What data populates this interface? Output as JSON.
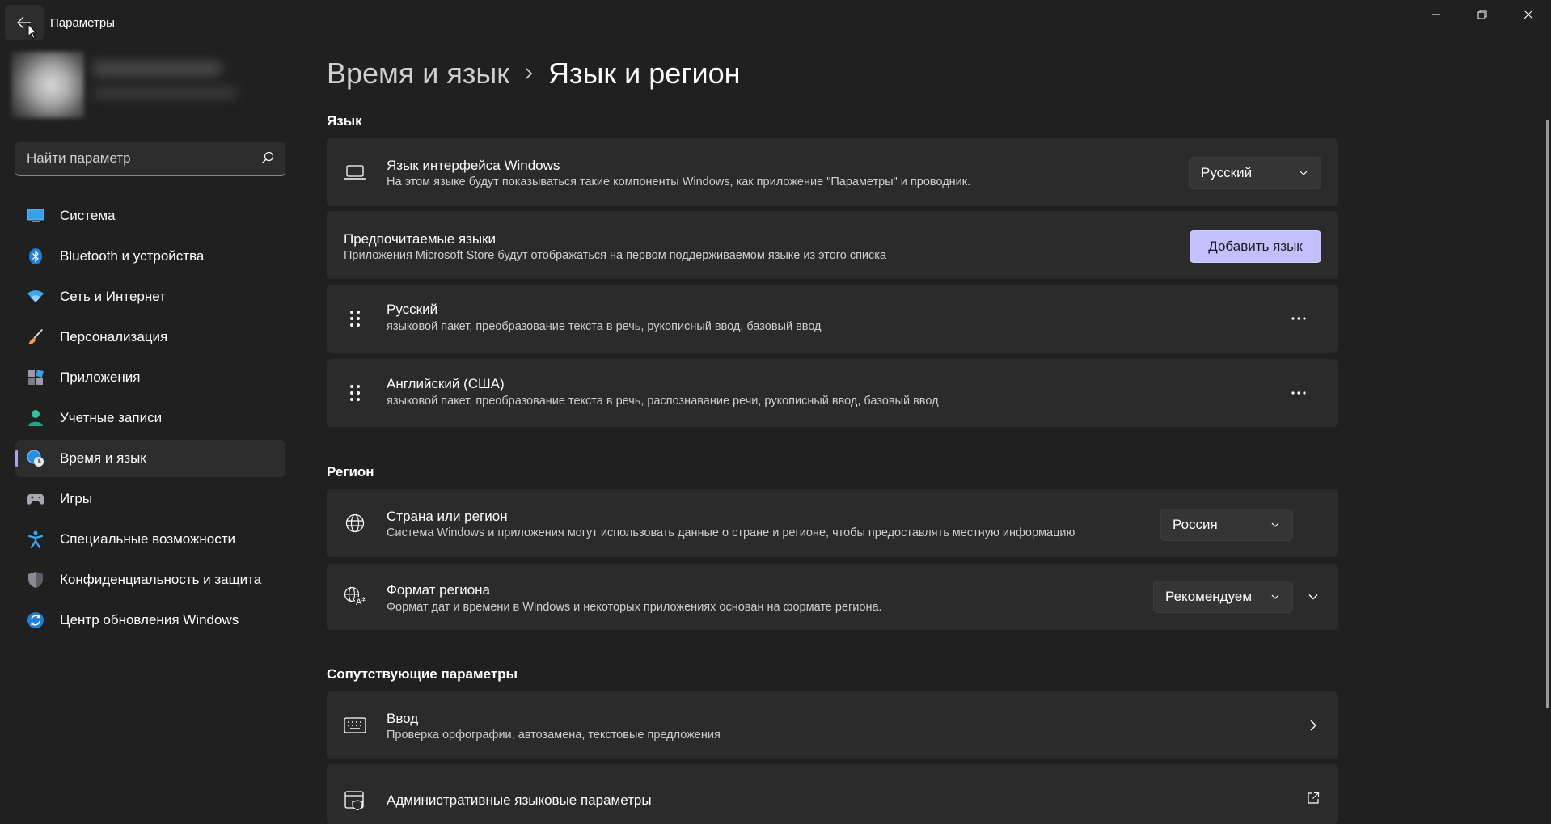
{
  "window": {
    "app_title": "Параметры",
    "minimize_icon": "minimize-icon",
    "maximize_icon": "restore-icon",
    "close_icon": "close-icon"
  },
  "sidebar": {
    "search_placeholder": "Найти параметр",
    "items": [
      {
        "label": "Система",
        "icon": "system-icon",
        "active": false
      },
      {
        "label": "Bluetooth и устройства",
        "icon": "bluetooth-icon",
        "active": false
      },
      {
        "label": "Сеть и Интернет",
        "icon": "wifi-icon",
        "active": false
      },
      {
        "label": "Персонализация",
        "icon": "brush-icon",
        "active": false
      },
      {
        "label": "Приложения",
        "icon": "apps-icon",
        "active": false
      },
      {
        "label": "Учетные записи",
        "icon": "person-icon",
        "active": false
      },
      {
        "label": "Время и язык",
        "icon": "time-language-icon",
        "active": true
      },
      {
        "label": "Игры",
        "icon": "gamepad-icon",
        "active": false
      },
      {
        "label": "Специальные возможности",
        "icon": "accessibility-icon",
        "active": false
      },
      {
        "label": "Конфиденциальность и защита",
        "icon": "shield-icon",
        "active": false
      },
      {
        "label": "Центр обновления Windows",
        "icon": "update-icon",
        "active": false
      }
    ]
  },
  "main": {
    "breadcrumb_parent": "Время и язык",
    "breadcrumb_current": "Язык и регион",
    "language_section": {
      "title": "Язык",
      "display_language": {
        "title": "Язык интерфейса Windows",
        "subtitle": "На этом языке будут показываться такие компоненты Windows, как приложение \"Параметры\" и проводник.",
        "value": "Русский"
      },
      "preferred": {
        "title": "Предпочитаемые языки",
        "subtitle": "Приложения Microsoft Store будут отображаться на первом поддерживаемом языке из этого списка",
        "button": "Добавить язык"
      },
      "languages": [
        {
          "name": "Русский",
          "features": "языковой пакет, преобразование текста в речь, рукописный ввод, базовый ввод"
        },
        {
          "name": "Английский (США)",
          "features": "языковой пакет, преобразование текста в речь, распознавание речи, рукописный ввод, базовый ввод"
        }
      ]
    },
    "region_section": {
      "title": "Регион",
      "country": {
        "title": "Страна или регион",
        "subtitle": "Система Windows и приложения могут использовать данные о стране и регионе, чтобы предоставлять местную информацию",
        "value": "Россия"
      },
      "format": {
        "title": "Формат региона",
        "subtitle": "Формат дат и времени в Windows и некоторых приложениях основан на формате региона.",
        "value": "Рекомендуем"
      }
    },
    "related_section": {
      "title": "Сопутствующие параметры",
      "typing": {
        "title": "Ввод",
        "subtitle": "Проверка орфографии, автозамена, текстовые предложения"
      },
      "admin": {
        "title": "Административные языковые параметры"
      }
    }
  },
  "colors": {
    "background": "#202020",
    "card": "#2b2b2b",
    "accent": "#c3c0ff",
    "active_indicator": "#a8a6f0"
  }
}
